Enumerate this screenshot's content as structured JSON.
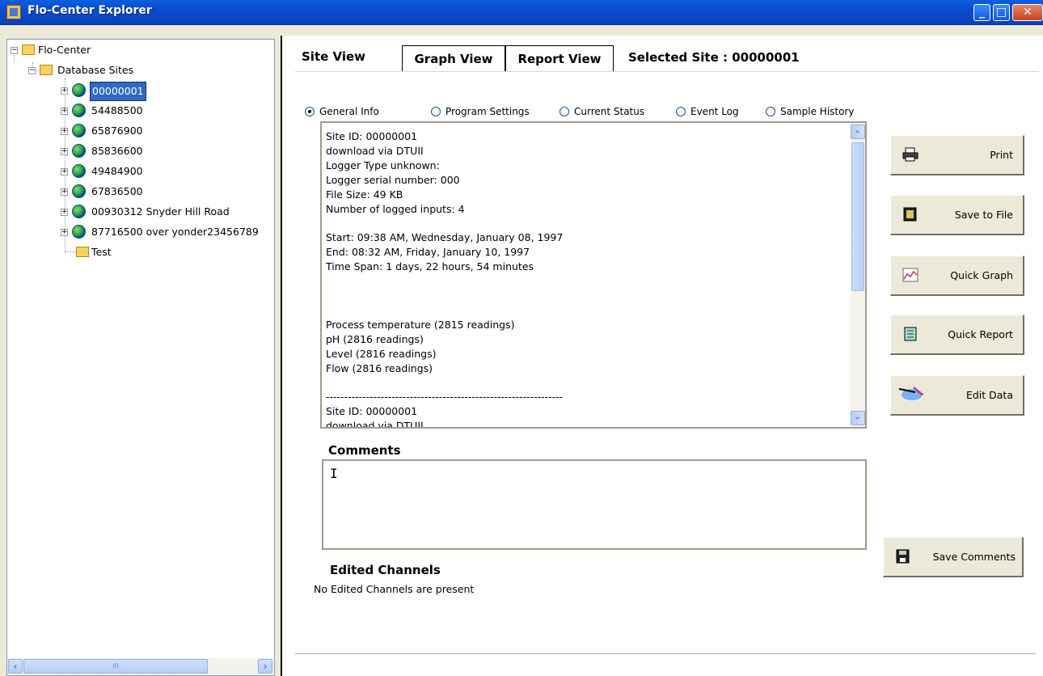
{
  "window": {
    "title": "Flo-Center Explorer",
    "min_label": "_",
    "max_label": "□",
    "close_label": "✕"
  },
  "tree": {
    "root": "Flo-Center",
    "database": "Database Sites",
    "sites": [
      "00000001",
      "54488500",
      "65876900",
      "85836600",
      "49484900",
      "67836500",
      "00930312 Snyder Hill Road",
      "87716500 over yonder23456789"
    ],
    "test": "Test",
    "scroll_grip": "III"
  },
  "tabs": {
    "site_view": "Site View",
    "graph_view": "Graph View",
    "report_view": "Report View"
  },
  "selected_site": "Selected Site : 00000001",
  "radios": {
    "general_info": "General Info",
    "program_settings": "Program Settings",
    "current_status": "Current Status",
    "event_log": "Event Log",
    "sample_history": "Sample History",
    "selected": "general_info"
  },
  "info_text": "Site ID: 00000001\ndownload via DTUII\nLogger Type unknown:\nLogger serial number: 000\nFile Size: 49 KB\nNumber of logged inputs: 4\n\nStart: 09:38 AM, Wednesday, January 08, 1997\nEnd: 08:32 AM, Friday, January 10, 1997\nTime Span: 1 days, 22 hours, 54 minutes\n\n\n\nProcess temperature (2815 readings)\npH (2816 readings)\nLevel (2816 readings)\nFlow (2816 readings)\n\n-----------------------------------------------------------------\nSite ID: 00000001\ndownload via DTUII",
  "comments": {
    "label": "Comments",
    "value": ""
  },
  "edited": {
    "label": "Edited Channels",
    "text": "No Edited Channels are present"
  },
  "buttons": {
    "print": "Print",
    "save_to_file": "Save to File",
    "quick_graph": "Quick Graph",
    "quick_report": "Quick Report",
    "edit_data": "Edit Data",
    "save_comments": "Save Comments"
  }
}
